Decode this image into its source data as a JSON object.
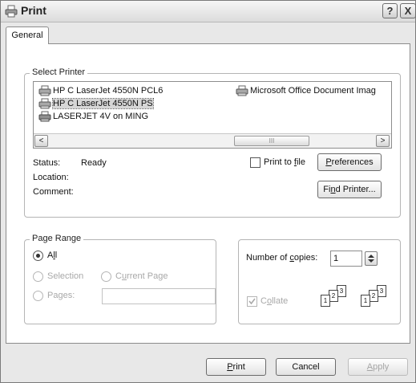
{
  "window": {
    "title": "Print"
  },
  "titlebar": {
    "help": "?",
    "close": "X"
  },
  "tabs": [
    {
      "label": "General"
    }
  ],
  "select_printer": {
    "legend": "Select Printer",
    "printers": [
      {
        "name": "HP C LaserJet 4550N PCL6",
        "selected": false
      },
      {
        "name": "HP C LaserJet 4550N PS",
        "selected": true
      },
      {
        "name": "LASERJET 4V on MING",
        "selected": false
      },
      {
        "name": "Microsoft Office Document Imag",
        "selected": false
      }
    ],
    "scroll_left": "<",
    "scroll_right": ">",
    "scroll_thumb": "III",
    "status_label": "Status:",
    "status_value": "Ready",
    "location_label": "Location:",
    "location_value": "",
    "comment_label": "Comment:",
    "comment_value": "",
    "print_to_file_pre": "Print to ",
    "print_to_file_u": "f",
    "print_to_file_post": "ile",
    "preferences_u": "P",
    "preferences_rest": "references",
    "find_printer_pre": "Fi",
    "find_printer_u": "n",
    "find_printer_post": "d Printer..."
  },
  "page_range": {
    "legend": "Page Range",
    "all_pre": "A",
    "all_u": "l",
    "all_post": "l",
    "selection_label": "Selection",
    "current_page_pre": "C",
    "current_page_u": "u",
    "current_page_post": "rrent Page",
    "pages_label": "Pages:",
    "pages_value": ""
  },
  "copies": {
    "label_pre": "Number of ",
    "label_u": "c",
    "label_post": "opies:",
    "value": "1",
    "collate_pre": "C",
    "collate_u": "o",
    "collate_post": "llate",
    "collate_checked": true,
    "page_numbers": [
      "1",
      "2",
      "3"
    ]
  },
  "buttons": {
    "print_u": "P",
    "print_rest": "rint",
    "cancel": "Cancel",
    "apply_u": "A",
    "apply_rest": "pply"
  }
}
